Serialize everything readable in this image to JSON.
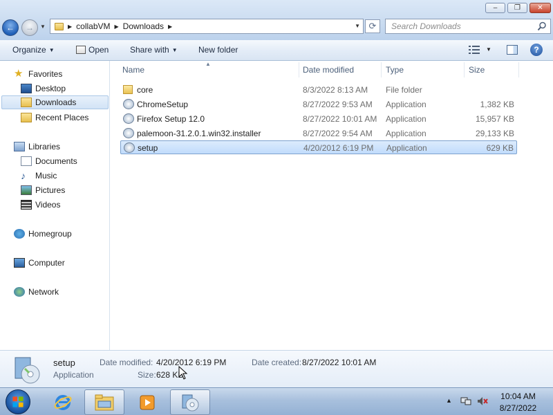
{
  "window": {
    "minimize_glyph": "‒",
    "maximize_glyph": "❐",
    "close_glyph": "✕"
  },
  "address": {
    "crumbs": [
      "collabVM",
      "Downloads"
    ],
    "search_placeholder": "Search Downloads"
  },
  "commands": {
    "organize": "Organize",
    "open": "Open",
    "share_with": "Share with",
    "new_folder": "New folder"
  },
  "nav": {
    "favorites": "Favorites",
    "desktop": "Desktop",
    "downloads": "Downloads",
    "recent_places": "Recent Places",
    "libraries": "Libraries",
    "documents": "Documents",
    "music": "Music",
    "pictures": "Pictures",
    "videos": "Videos",
    "homegroup": "Homegroup",
    "computer": "Computer",
    "network": "Network"
  },
  "columns": {
    "name": "Name",
    "date_modified": "Date modified",
    "type": "Type",
    "size": "Size"
  },
  "files": [
    {
      "name": "core",
      "date": "8/3/2022 8:13 AM",
      "type": "File folder",
      "size": ""
    },
    {
      "name": "ChromeSetup",
      "date": "8/27/2022 9:53 AM",
      "type": "Application",
      "size": "1,382 KB"
    },
    {
      "name": "Firefox Setup 12.0",
      "date": "8/27/2022 10:01 AM",
      "type": "Application",
      "size": "15,957 KB"
    },
    {
      "name": "palemoon-31.2.0.1.win32.installer",
      "date": "8/27/2022 9:54 AM",
      "type": "Application",
      "size": "29,133 KB"
    },
    {
      "name": "setup",
      "date": "4/20/2012 6:19 PM",
      "type": "Application",
      "size": "629 KB"
    }
  ],
  "details": {
    "name": "setup",
    "type": "Application",
    "date_modified_label": "Date modified:",
    "date_modified": "4/20/2012 6:19 PM",
    "size_label": "Size:",
    "size": "628 KB",
    "date_created_label": "Date created:",
    "date_created": "8/27/2022 10:01 AM"
  },
  "taskbar": {
    "time": "10:04 AM",
    "date": "8/27/2022"
  },
  "colors": {
    "selection": "#c1dcfc",
    "selection_border": "#7da2ce",
    "link_text": "#1e2b40"
  }
}
